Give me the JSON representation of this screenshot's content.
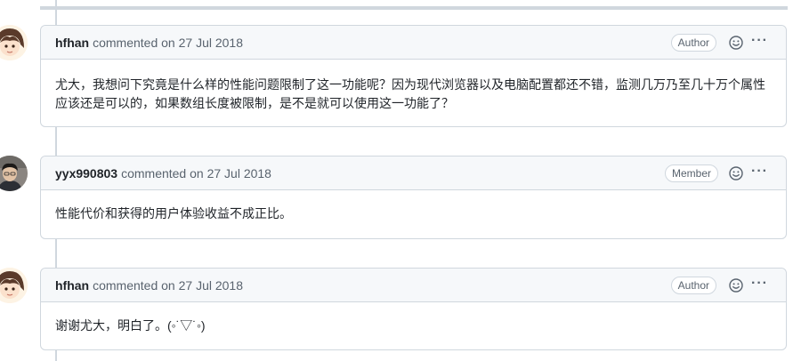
{
  "comments": [
    {
      "author": "hfhan",
      "meta": "commented on 27 Jul 2018",
      "role": "Author",
      "avatar": "anime-avatar",
      "body": "尤大，我想问下究竟是什么样的性能问题限制了这一功能呢？因为现代浏览器以及电脑配置都还不错，监测几万乃至几十万个属性应该还是可以的，如果数组长度被限制，是不是就可以使用这一功能了？"
    },
    {
      "author": "yyx990803",
      "meta": "commented on 27 Jul 2018",
      "role": "Member",
      "avatar": "photo-avatar",
      "body": "性能代价和获得的用户体验收益不成正比。"
    },
    {
      "author": "hfhan",
      "meta": "commented on 27 Jul 2018",
      "role": "Author",
      "avatar": "anime-avatar",
      "body": "谢谢尤大，明白了。(◦˙▽˙◦)"
    }
  ],
  "icons": {
    "reaction": "smiley-icon",
    "more": "kebab-horizontal-icon"
  },
  "more_label": "···",
  "colors": {
    "border": "#d0d7de",
    "header_bg": "#f6f8fa",
    "text": "#1f2328",
    "muted": "#59636e"
  }
}
